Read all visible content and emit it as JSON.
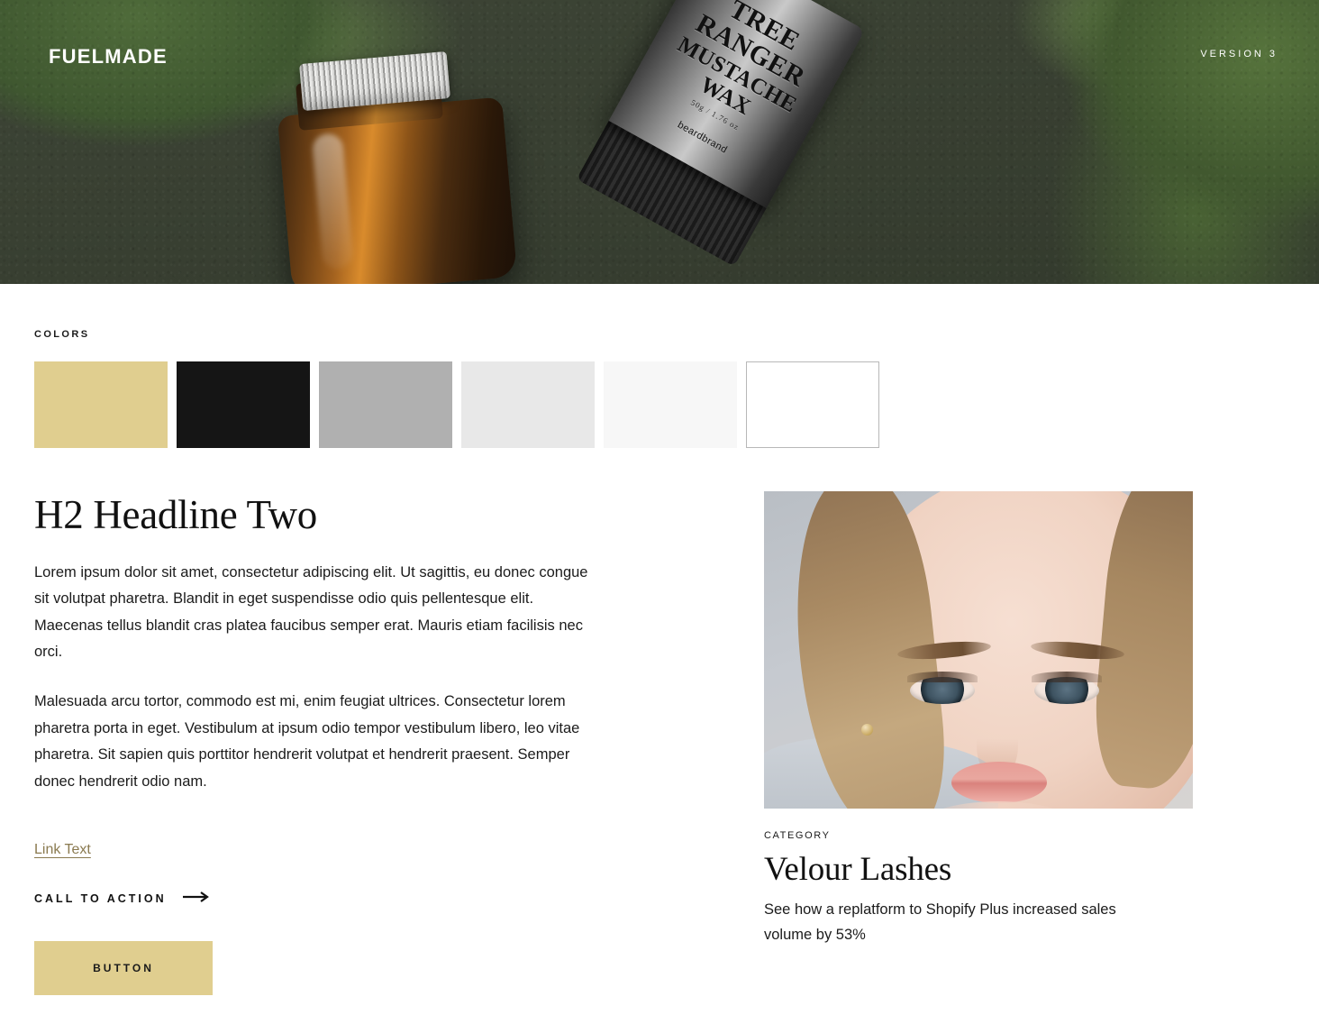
{
  "header": {
    "logo": "FUELMADE",
    "logo_part_1": "FUEL",
    "logo_part_2": "MADE",
    "version": "VERSION 3"
  },
  "colors_section": {
    "label": "COLORS",
    "swatches": [
      {
        "name": "tan",
        "hex": "#E0CE8F",
        "border": "none"
      },
      {
        "name": "near-black",
        "hex": "#151515",
        "border": "none"
      },
      {
        "name": "mid-gray",
        "hex": "#B0B0B0",
        "border": "none"
      },
      {
        "name": "light-gray",
        "hex": "#E8E8E8",
        "border": "none"
      },
      {
        "name": "off-white",
        "hex": "#F7F7F7",
        "border": "none"
      },
      {
        "name": "white",
        "hex": "#FFFFFF",
        "border": "1px solid #B8B8B8"
      }
    ]
  },
  "main": {
    "headline": "H2 Headline Two",
    "paragraph_1": "Lorem ipsum dolor sit amet, consectetur adipiscing elit. Ut sagittis, eu donec congue sit volutpat pharetra. Blandit in eget suspendisse odio quis pellentesque elit. Maecenas tellus blandit cras platea faucibus semper erat. Mauris etiam facilisis nec orci.",
    "paragraph_2": "Malesuada arcu tortor, commodo est mi, enim feugiat ultrices. Consectetur lorem pharetra porta in eget. Vestibulum at ipsum odio tempor vestibulum libero, leo vitae pharetra. Sit sapien quis porttitor hendrerit volutpat et hendrerit praesent. Semper donec hendrerit odio nam.",
    "link_text": "Link Text",
    "link_color": "#8A7A50",
    "cta_label": "CALL TO ACTION",
    "button_label": "BUTTON",
    "button_color": "#E0CE8F"
  },
  "card": {
    "category": "CATEGORY",
    "title": "Velour Lashes",
    "description": "See how a replatform to Shopify Plus increased sales volume by 53%"
  },
  "hero_product": {
    "tube_line_1": "TREE RANGER",
    "tube_line_2": "MUSTACHE WAX",
    "tube_line_3": "50g / 1.76 oz",
    "tube_brand": "beardbrand"
  }
}
